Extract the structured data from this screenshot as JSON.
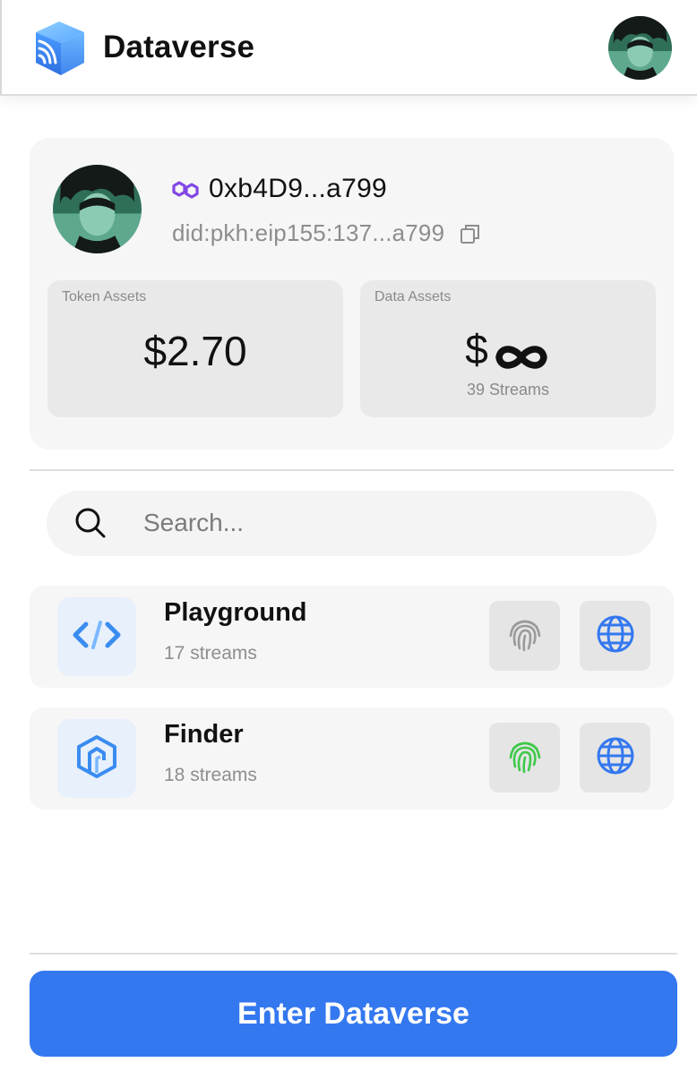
{
  "header": {
    "title": "Dataverse",
    "logo_icon": "dataverse-cube-logo",
    "avatar_icon": "user-avatar"
  },
  "profile": {
    "address": "0xb4D9...a799",
    "did": "did:pkh:eip155:137...a799",
    "chain_icon": "polygon-icon",
    "copy_icon": "copy-icon",
    "token_assets": {
      "label": "Token Assets",
      "value": "$2.70"
    },
    "data_assets": {
      "label": "Data Assets",
      "value": "$",
      "value_icon": "infinity-icon",
      "sub": "39 Streams"
    }
  },
  "search": {
    "placeholder": "Search...",
    "value": ""
  },
  "apps": [
    {
      "name": "Playground",
      "streams": "17 streams",
      "icon": "code-icon",
      "fingerprint_active": false
    },
    {
      "name": "Finder",
      "streams": "18 streams",
      "icon": "finder-logo-icon",
      "fingerprint_active": true
    }
  ],
  "footer": {
    "button_label": "Enter Dataverse"
  },
  "colors": {
    "accent": "#3478f0",
    "fingerprint_active": "#3ec94a",
    "fingerprint_inactive": "#9a9a9a",
    "globe": "#3478f0",
    "polygon": "#8247e5"
  }
}
